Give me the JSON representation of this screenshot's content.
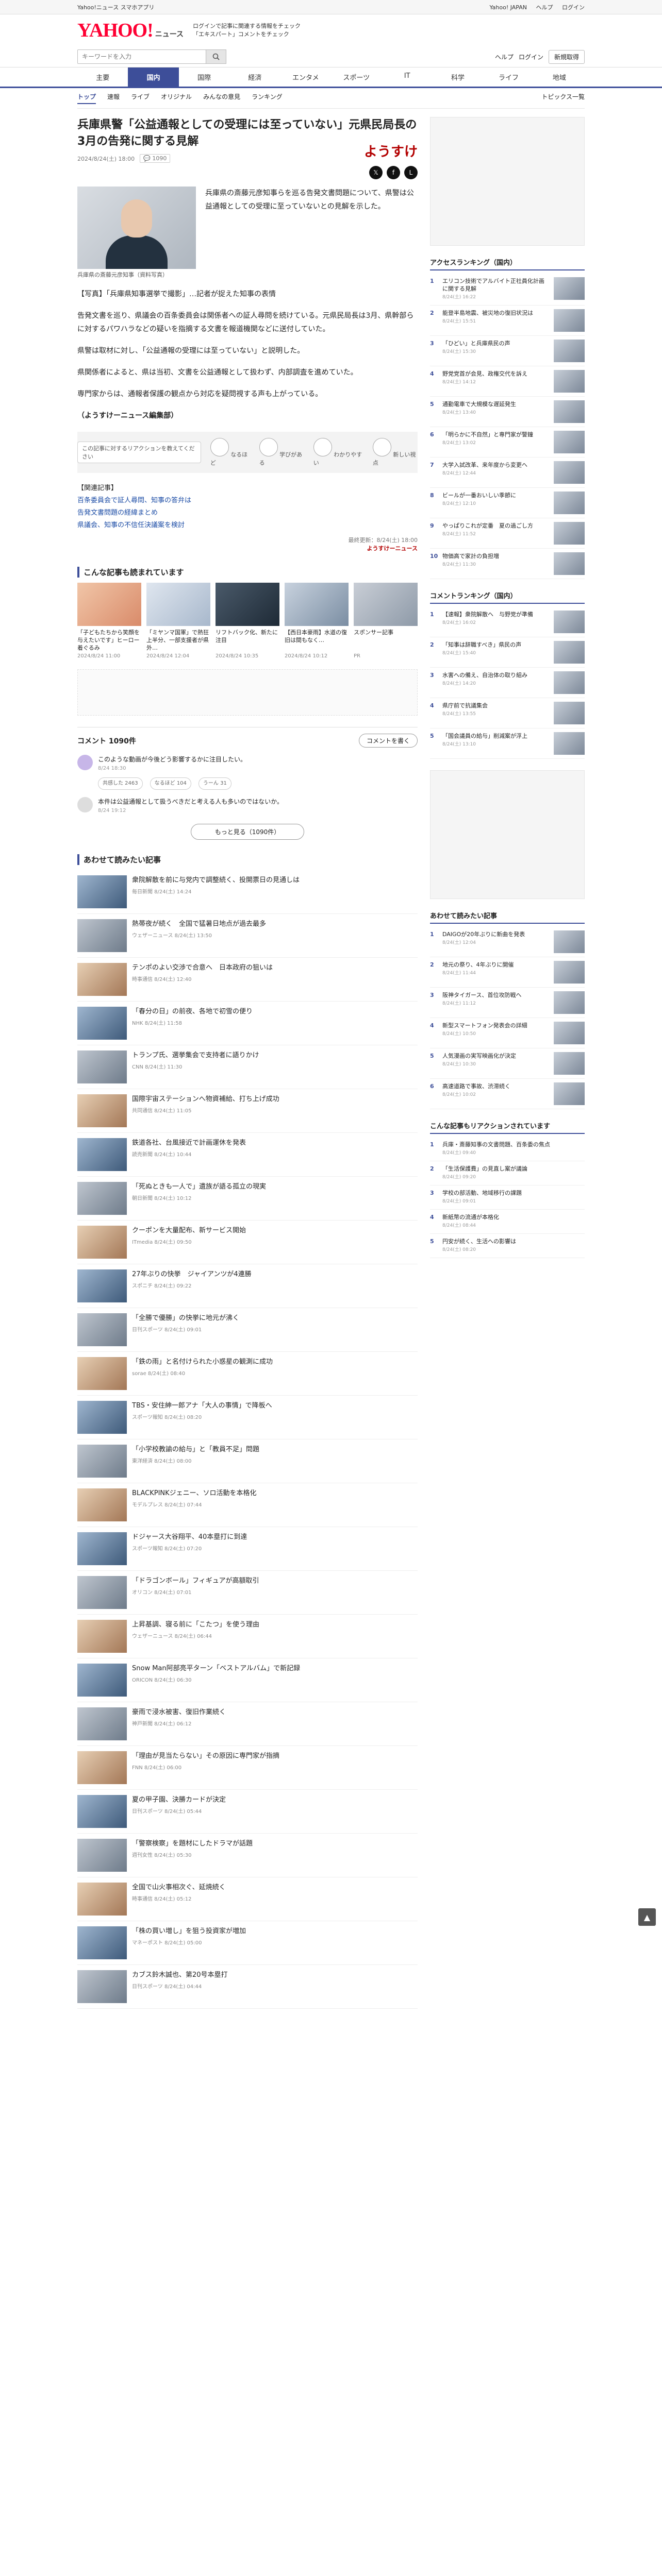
{
  "topbar": {
    "notice": "Yahoo!ニュース スマホアプリ",
    "links": [
      "Yahoo! JAPAN",
      "ヘルプ",
      "ログイン"
    ]
  },
  "header": {
    "logo": "YAHOO!",
    "logo_sub": "ニュース",
    "promo_line1": "ログインで記事に関連する情報をチェック",
    "promo_line2": "「エキスパート」コメントをチェック"
  },
  "search": {
    "placeholder": "キーワードを入力",
    "links": [
      "ヘルプ",
      "ログイン"
    ],
    "login": "新規取得"
  },
  "categories": [
    "主要",
    "国内",
    "国際",
    "経済",
    "エンタメ",
    "スポーツ",
    "IT",
    "科学",
    "ライフ",
    "地域"
  ],
  "subnav": [
    "トップ",
    "速報",
    "ライブ",
    "オリジナル",
    "みんなの意見",
    "ランキング"
  ],
  "subnav_topics": "トピックス一覧",
  "article": {
    "title": "兵庫県警「公益通報としての受理には至っていない」元県民局長の3月の告発に関する見解",
    "date": "2024/8/24(土) 18:00",
    "comments_count": "1090",
    "provider": "ようすけ",
    "photo_caption": "兵庫県の斎藤元彦知事（資料写真）",
    "lead": "兵庫県の斎藤元彦知事らを巡る告発文書問題について、県警は公益通報としての受理に至っていないとの見解を示した。",
    "p1": "【写真】「兵庫県知事選挙で撮影」…記者が捉えた知事の表情",
    "p2": "告発文書を巡り、県議会の百条委員会は関係者への証人尋問を続けている。元県民局長は3月、県幹部らに対するパワハラなどの疑いを指摘する文書を報道機関などに送付していた。",
    "p3": "県警は取材に対し、「公益通報の受理には至っていない」と説明した。",
    "quote_head": "（ようすけーニュース編集部）",
    "p4": "県関係者によると、県は当初、文書を公益通報として扱わず、内部調査を進めていた。",
    "p5": "専門家からは、通報者保護の観点から対応を疑問視する声も上がっている。"
  },
  "banner": {
    "bubble": "この記事に対するリアクションを教えてください",
    "reactions": [
      "なるほど",
      "学びがある",
      "わかりやすい",
      "新しい視点"
    ]
  },
  "related": {
    "head": "【関連記事】",
    "items": [
      "百条委員会で証人尋問、知事の答弁は",
      "告発文書問題の経緯まとめ",
      "県議会、知事の不信任決議案を検討"
    ]
  },
  "footer_meta": "最終更新：8/24(土) 18:00",
  "footer_provider": "ようすけーニュース",
  "more_related_title": "こんな記事も読まれています",
  "cards": [
    {
      "title": "「子どもたちから笑顔を与えたいです」ヒーロー着ぐるみ",
      "src": "2024/8/24 11:00"
    },
    {
      "title": "「ミヤンマ国軍」で熱狂上半分、一部支援者が県外…",
      "src": "2024/8/24 12:04"
    },
    {
      "title": "リフトバック化、新たに注目",
      "src": "2024/8/24 10:35"
    },
    {
      "title": "【西日本豪雨】水道の復旧は間もなく…",
      "src": "2024/8/24 10:12"
    },
    {
      "title": "スポンサー記事",
      "src": "PR"
    }
  ],
  "comments": {
    "title": "コメント",
    "count": "1090",
    "count_suffix": "件",
    "write": "コメントを書く",
    "first_text": "このような動画が今後どう影響するかに注目したい。",
    "first_date": "8/24 18:30",
    "first_reactions": [
      "共感した 2463",
      "なるほど 104",
      "うーん 31"
    ],
    "second_text": "本件は公益通報として扱うべきだと考える人も多いのではないか。",
    "second_date": "8/24 19:12",
    "more": "もっと見る（1090件）"
  },
  "recommend_title": "あわせて読みたい記事",
  "news": [
    {
      "title": "衆院解散を前に与党内で調整続く、投開票日の見通しは",
      "src": "毎日新聞 8/24(土) 14:24"
    },
    {
      "title": "熱帯夜が続く　全国で猛暑日地点が過去最多",
      "src": "ウェザーニュース 8/24(土) 13:50"
    },
    {
      "title": "テンポのよい交渉で合意へ　日本政府の狙いは",
      "src": "時事通信 8/24(土) 12:40"
    },
    {
      "title": "「春分の日」の前夜、各地で初雪の便り",
      "src": "NHK 8/24(土) 11:58"
    },
    {
      "title": "トランプ氏、選挙集会で支持者に語りかけ",
      "src": "CNN 8/24(土) 11:30"
    },
    {
      "title": "国際宇宙ステーションへ物資補給、打ち上げ成功",
      "src": "共同通信 8/24(土) 11:05"
    },
    {
      "title": "鉄道各社、台風接近で計画運休を発表",
      "src": "読売新聞 8/24(土) 10:44"
    },
    {
      "title": "「死ぬときも一人で」遺族が語る孤立の現実",
      "src": "朝日新聞 8/24(土) 10:12"
    },
    {
      "title": "クーポンを大量配布、新サービス開始",
      "src": "ITmedia 8/24(土) 09:50"
    },
    {
      "title": "27年ぶりの快挙　ジャイアンツが4連勝",
      "src": "スポニチ 8/24(土) 09:22"
    },
    {
      "title": "「全勝で優勝」の快挙に地元が沸く",
      "src": "日刊スポーツ 8/24(土) 09:01"
    },
    {
      "title": "「鉄の雨」と名付けられた小惑星の観測に成功",
      "src": "sorae 8/24(土) 08:40"
    },
    {
      "title": "TBS・安住紳一郎アナ「大人の事情」で降板へ",
      "src": "スポーツ報知 8/24(土) 08:20"
    },
    {
      "title": "「小学校教諭の給与」と「教員不足」問題",
      "src": "東洋経済 8/24(土) 08:00"
    },
    {
      "title": "BLACKPINKジェニー、ソロ活動を本格化",
      "src": "モデルプレス 8/24(土) 07:44"
    },
    {
      "title": "ドジャース大谷翔平、40本塁打に到達",
      "src": "スポーツ報知 8/24(土) 07:20"
    },
    {
      "title": "「ドラゴンボール」フィギュアが高額取引",
      "src": "オリコン 8/24(土) 07:01"
    },
    {
      "title": "上昇基調、寝る前に「こたつ」を使う理由",
      "src": "ウェザーニュース 8/24(土) 06:44"
    },
    {
      "title": "Snow Man阿部亮平ターン「ベストアルバム」で新記録",
      "src": "ORICON 8/24(土) 06:30"
    },
    {
      "title": "豪雨で浸水被害、復旧作業続く",
      "src": "神戸新聞 8/24(土) 06:12"
    },
    {
      "title": "「理由が見当たらない」その原因に専門家が指摘",
      "src": "FNN 8/24(土) 06:00"
    },
    {
      "title": "夏の甲子園、決勝カードが決定",
      "src": "日刊スポーツ 8/24(土) 05:44"
    },
    {
      "title": "「警察検察」を題材にしたドラマが話題",
      "src": "週刊女性 8/24(土) 05:30"
    },
    {
      "title": "全国で山火事相次ぐ、延焼続く",
      "src": "時事通信 8/24(土) 05:12"
    },
    {
      "title": "「株の買い増し」を狙う投資家が増加",
      "src": "マネーポスト 8/24(土) 05:00"
    },
    {
      "title": "カブス鈴木誠也、第20号本塁打",
      "src": "日刊スポーツ 8/24(土) 04:44"
    }
  ],
  "side": {
    "ranking_title": "アクセスランキング（国内）",
    "ranking": [
      {
        "t": "エリコン技術でアルバイト正社員化計画に関する見解",
        "s": "8/24(土) 16:22"
      },
      {
        "t": "能登半島地震、被災地の復旧状況は",
        "s": "8/24(土) 15:51"
      },
      {
        "t": "「ひどい」と兵庫県民の声",
        "s": "8/24(土) 15:30"
      },
      {
        "t": "野党党首が会見、政権交代を訴え",
        "s": "8/24(土) 14:12"
      },
      {
        "t": "通勤電車で大規模な遅延発生",
        "s": "8/24(土) 13:40"
      },
      {
        "t": "「明らかに不自然」と専門家が警鐘",
        "s": "8/24(土) 13:02"
      },
      {
        "t": "大学入試改革、来年度から変更へ",
        "s": "8/24(土) 12:44"
      },
      {
        "t": "ビールが一番おいしい季節に",
        "s": "8/24(土) 12:10"
      },
      {
        "t": "やっぱりこれが定番　夏の過ごし方",
        "s": "8/24(土) 11:52"
      },
      {
        "t": "物価高で家計の負担増",
        "s": "8/24(土) 11:30"
      }
    ],
    "comment_rank_title": "コメントランキング（国内）",
    "comment_rank": [
      {
        "t": "【速報】衆院解散へ　与野党が準備",
        "s": "8/24(土) 16:02"
      },
      {
        "t": "「知事は辞職すべき」県民の声",
        "s": "8/24(土) 15:40"
      },
      {
        "t": "水害への備え、自治体の取り組み",
        "s": "8/24(土) 14:20"
      },
      {
        "t": "県庁前で抗議集会",
        "s": "8/24(土) 13:55"
      },
      {
        "t": "「国会議員の給与」削減案が浮上",
        "s": "8/24(土) 13:10"
      }
    ],
    "rec_title": "あわせて読みたい記事",
    "rec": [
      {
        "t": "DAIGOが20年ぶりに新曲を発表",
        "s": "8/24(土) 12:04"
      },
      {
        "t": "地元の祭り、4年ぶりに開催",
        "s": "8/24(土) 11:44"
      },
      {
        "t": "阪神タイガース、首位攻防戦へ",
        "s": "8/24(土) 11:12"
      },
      {
        "t": "新型スマートフォン発表会の詳細",
        "s": "8/24(土) 10:50"
      },
      {
        "t": "人気漫画の実写映画化が決定",
        "s": "8/24(土) 10:30"
      },
      {
        "t": "高速道路で事故、渋滞続く",
        "s": "8/24(土) 10:02"
      }
    ],
    "expert_title": "こんな記事もリアクションされています",
    "expert": [
      {
        "t": "兵庫・斎藤知事の文書問題、百条委の焦点",
        "s": "8/24(土) 09:40"
      },
      {
        "t": "「生活保護費」の見直し案が議論",
        "s": "8/24(土) 09:20"
      },
      {
        "t": "学校の部活動、地域移行の課題",
        "s": "8/24(土) 09:01"
      },
      {
        "t": "新紙幣の流通が本格化",
        "s": "8/24(土) 08:44"
      },
      {
        "t": "円安が続く、生活への影響は",
        "s": "8/24(土) 08:20"
      }
    ]
  },
  "pagetop": "▲"
}
